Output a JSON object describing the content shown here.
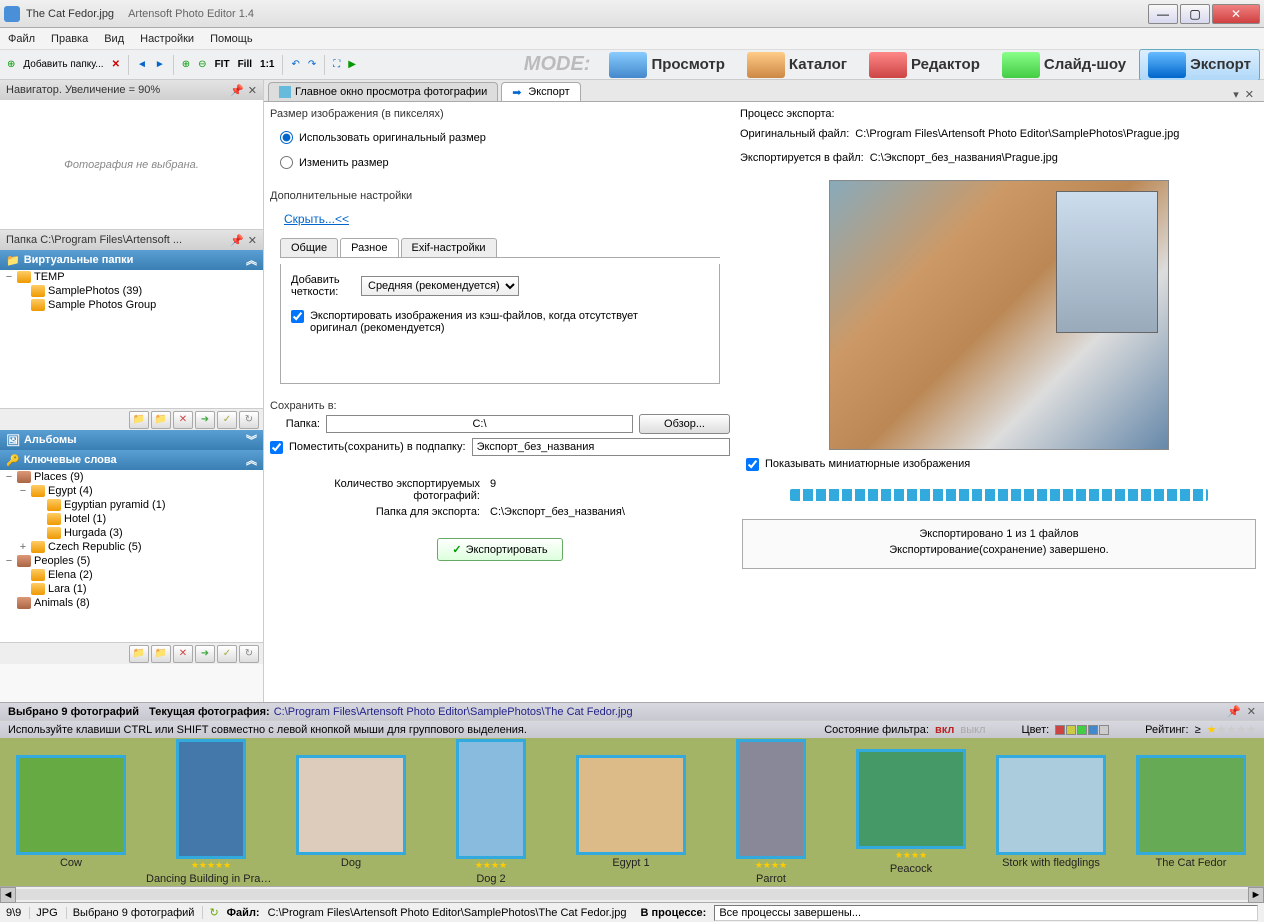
{
  "title": {
    "file": "The Cat Fedor.jpg",
    "app": "Artensoft Photo Editor 1.4"
  },
  "menu": [
    "Файл",
    "Правка",
    "Вид",
    "Настройки",
    "Помощь"
  ],
  "toolbar": {
    "add_folder": "Добавить папку...",
    "fit": "FIT",
    "fill": "Fill",
    "one": "1:1"
  },
  "mode_label": "MODE:",
  "modes": [
    {
      "label": "Просмотр"
    },
    {
      "label": "Каталог"
    },
    {
      "label": "Редактор"
    },
    {
      "label": "Слайд-шоу"
    },
    {
      "label": "Экспорт",
      "active": true
    }
  ],
  "navigator": {
    "title": "Навигатор. Увеличение = 90%",
    "empty": "Фотография не выбрана."
  },
  "folder_panel": {
    "title": "Папка C:\\Program Files\\Artensoft ..."
  },
  "virtual_folders": {
    "title": "Виртуальные папки",
    "items": [
      {
        "label": "TEMP",
        "exp": "−"
      },
      {
        "label": "SamplePhotos (39)",
        "indent": 1
      },
      {
        "label": "Sample Photos Group",
        "indent": 1
      }
    ]
  },
  "albums": {
    "title": "Альбомы"
  },
  "keywords": {
    "title": "Ключевые слова",
    "items": [
      {
        "label": "Places (9)",
        "exp": "−",
        "brief": true
      },
      {
        "label": "Egypt  (4)",
        "exp": "−",
        "indent": 1
      },
      {
        "label": "Egyptian pyramid  (1)",
        "indent": 2
      },
      {
        "label": "Hotel  (1)",
        "indent": 2
      },
      {
        "label": "Hurgada  (3)",
        "indent": 2
      },
      {
        "label": "Czech Republic  (5)",
        "exp": "+",
        "indent": 1
      },
      {
        "label": "Peoples (5)",
        "exp": "−",
        "brief": true
      },
      {
        "label": "Elena  (2)",
        "indent": 1
      },
      {
        "label": "Lara  (1)",
        "indent": 1
      },
      {
        "label": "Animals  (8)",
        "brief": true
      }
    ]
  },
  "main_tabs": [
    {
      "label": "Главное окно просмотра фотографии"
    },
    {
      "label": "Экспорт",
      "active": true
    }
  ],
  "export": {
    "size_label": "Размер изображения (в пикселях)",
    "radio_original": "Использовать оригинальный размер",
    "radio_resize": "Изменить размер",
    "adv_label": "Дополнительные настройки",
    "hide_link": "Скрыть...<<",
    "subtabs": [
      "Общие",
      "Разное",
      "Exif-настройки"
    ],
    "sharpen_label": "Добавить четкости:",
    "sharpen_value": "Средняя (рекомендуется)",
    "cache_cb": "Экспортировать изображения из кэш-файлов, когда отсутствует оригинал (рекомендуется)",
    "save_label": "Сохранить в:",
    "folder_lbl": "Папка:",
    "folder_val": "C:\\",
    "browse": "Обзор...",
    "subfolder_cb": "Поместить(сохранить) в подпапку:",
    "subfolder_val": "Экспорт_без_названия",
    "count_lbl": "Количество экспортируемых фотографий:",
    "count_val": "9",
    "dest_lbl": "Папка для экспорта:",
    "dest_val": "C:\\Экспорт_без_названия\\",
    "export_btn": "Экспортировать"
  },
  "process": {
    "title": "Процесс экспорта:",
    "orig_lbl": "Оригинальный файл:",
    "orig_val": "C:\\Program Files\\Artensoft Photo Editor\\SamplePhotos\\Prague.jpg",
    "dest_lbl": "Экспортируется в файл:",
    "dest_val": "C:\\Экспорт_без_названия\\Prague.jpg",
    "show_thumb": "Показывать миниатюрные изображения",
    "status1": "Экспортировано 1  из  1 файлов",
    "status2": "Экспортирование(сохранение) завершено."
  },
  "info": {
    "selected": "Выбрано 9   фотографий",
    "current_lbl": "Текущая фотография:",
    "current_val": "C:\\Program Files\\Artensoft Photo Editor\\SamplePhotos\\The Cat Fedor.jpg",
    "hint": "Используйте клавиши CTRL или SHIFT совместно с левой кнопкой мыши для группового выделения.",
    "filter_lbl": "Состояние фильтра:",
    "filter_on": "вкл",
    "filter_off": "выкл",
    "color_lbl": "Цвет:",
    "rating_lbl": "Рейтинг:"
  },
  "thumbs": [
    {
      "name": "Cow",
      "bg": "#6a4",
      "stars": 0
    },
    {
      "name": "Dancing Building in Prague",
      "bg": "#47a",
      "stars": 5,
      "portrait": true
    },
    {
      "name": "Dog",
      "bg": "#dcb",
      "stars": 0
    },
    {
      "name": "Dog 2",
      "bg": "#8bd",
      "stars": 4,
      "portrait": true
    },
    {
      "name": "Egypt 1",
      "bg": "#db8",
      "stars": 0
    },
    {
      "name": "Parrot",
      "bg": "#889",
      "stars": 4,
      "portrait": true
    },
    {
      "name": "Peacock",
      "bg": "#496",
      "stars": 4
    },
    {
      "name": "Stork with fledglings",
      "bg": "#acd",
      "stars": 0
    },
    {
      "name": "The Cat Fedor",
      "bg": "#6a5",
      "stars": 0
    }
  ],
  "status": {
    "count": "9\\9",
    "fmt": "JPG",
    "sel": "Выбрано 9 фотографий",
    "file_lbl": "Файл:",
    "file_val": "C:\\Program Files\\Artensoft Photo Editor\\SamplePhotos\\The Cat Fedor.jpg",
    "proc_lbl": "В процессе:",
    "proc_val": "Все процессы завершены..."
  }
}
